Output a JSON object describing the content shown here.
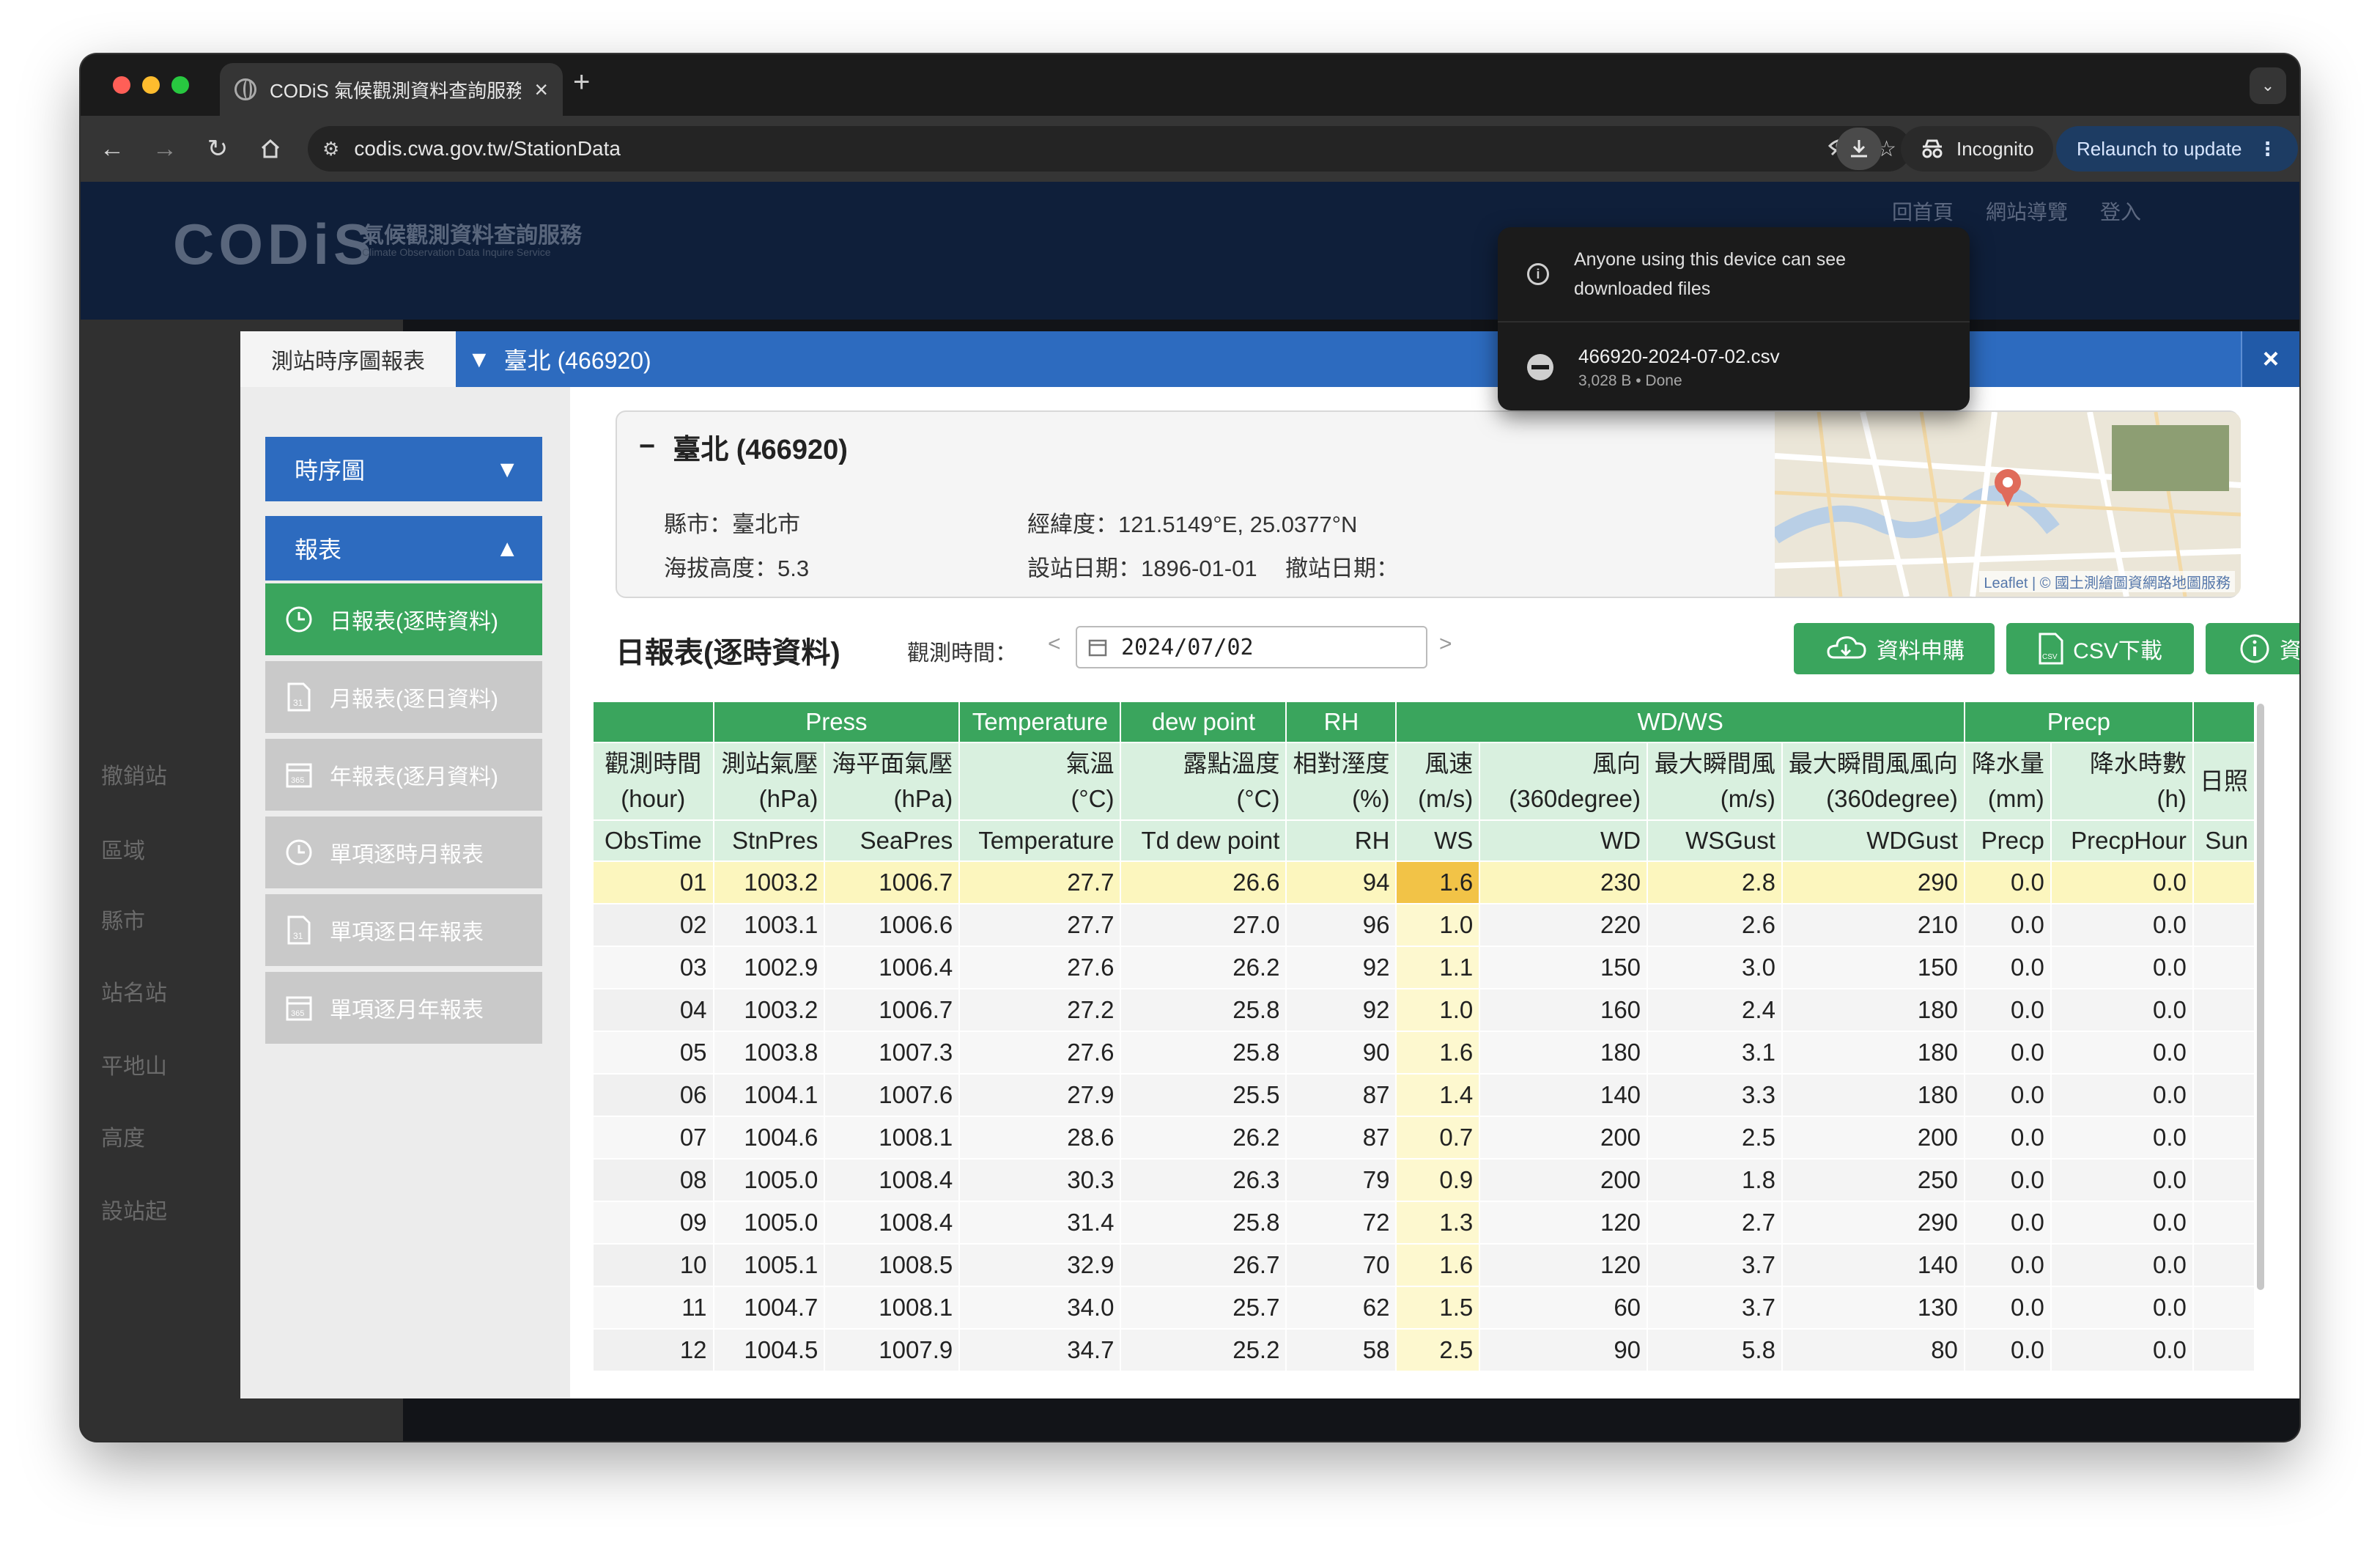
{
  "browser": {
    "tab_title": "CODiS 氣候觀測資料查詢服務",
    "url": "codis.cwa.gov.tw/StationData",
    "incognito_label": "Incognito",
    "relaunch_label": "Relaunch to update",
    "traffic_colors": [
      "#ff5f57",
      "#febc2e",
      "#28c840"
    ]
  },
  "download_bubble": {
    "warning": "Anyone using this device can see downloaded files",
    "file_name": "466920-2024-07-02.csv",
    "file_meta": "3,028 B • Done"
  },
  "site": {
    "logo": "CODiS",
    "name": "氣候觀測資料查詢服務",
    "subtitle": "Climate Observation Data Inquire Service",
    "links": [
      "回首頁",
      "網站導覽",
      "登入"
    ],
    "left_labels": [
      "撤銷站",
      "區域",
      "縣市",
      "站名站",
      "平地山",
      "高度",
      "設站起"
    ]
  },
  "modal": {
    "tab_label": "測站時序圖報表",
    "station_tab": "臺北 (466920)",
    "close": "×",
    "accent_blue": "#2d6bbf",
    "accent_green": "#3aa55d"
  },
  "sidebar": {
    "timeseries": "時序圖",
    "reports": "報表",
    "items": [
      {
        "label": "日報表(逐時資料)",
        "icon": "clock-icon",
        "active": true
      },
      {
        "label": "月報表(逐日資料)",
        "icon": "document-icon",
        "active": false
      },
      {
        "label": "年報表(逐月資料)",
        "icon": "calendar-icon",
        "active": false
      },
      {
        "label": "單項逐時月報表",
        "icon": "clock-icon",
        "active": false
      },
      {
        "label": "單項逐日年報表",
        "icon": "document-icon",
        "active": false
      },
      {
        "label": "單項逐月年報表",
        "icon": "calendar-icon",
        "active": false
      }
    ]
  },
  "station": {
    "name": "臺北 (466920)",
    "county": "縣市：臺北市",
    "altitude": "海拔高度：5.3",
    "coords": "經緯度：121.5149°E, 25.0377°N",
    "established": "設站日期：1896-01-01",
    "removed": "撤站日期：",
    "map_attribution": "Leaflet | © 國土測繪圖資網路地圖服務"
  },
  "report": {
    "title": "日報表(逐時資料)",
    "obs_label": "觀測時間：",
    "date": "2024/07/02",
    "btn_apply": "資料申購",
    "btn_csv": "CSV下載",
    "btn_info": "資料說明"
  },
  "table": {
    "groups": [
      "",
      "Press",
      "Temperature",
      "dew point",
      "RH",
      "WD/WS",
      "Precp",
      ""
    ],
    "headers_zh": [
      "觀測時間",
      "測站氣壓",
      "海平面氣壓",
      "氣溫",
      "露點溫度",
      "相對溼度",
      "風速",
      "風向",
      "最大瞬間風",
      "最大瞬間風風向",
      "降水量",
      "降水時數",
      "日照"
    ],
    "headers_unit": [
      "(hour)",
      "(hPa)",
      "(hPa)",
      "(°C)",
      "(°C)",
      "(%)",
      "(m/s)",
      "(360degree)",
      "(m/s)",
      "(360degree)",
      "(mm)",
      "(h)",
      ""
    ],
    "codes": [
      "ObsTime",
      "StnPres",
      "SeaPres",
      "Temperature",
      "Td dew point",
      "RH",
      "WS",
      "WD",
      "WSGust",
      "WDGust",
      "Precp",
      "PrecpHour",
      "Sun"
    ],
    "rows": [
      [
        "01",
        "1003.2",
        "1006.7",
        "27.7",
        "26.6",
        "94",
        "1.6",
        "230",
        "2.8",
        "290",
        "0.0",
        "0.0",
        ""
      ],
      [
        "02",
        "1003.1",
        "1006.6",
        "27.7",
        "27.0",
        "96",
        "1.0",
        "220",
        "2.6",
        "210",
        "0.0",
        "0.0",
        ""
      ],
      [
        "03",
        "1002.9",
        "1006.4",
        "27.6",
        "26.2",
        "92",
        "1.1",
        "150",
        "3.0",
        "150",
        "0.0",
        "0.0",
        ""
      ],
      [
        "04",
        "1003.2",
        "1006.7",
        "27.2",
        "25.8",
        "92",
        "1.0",
        "160",
        "2.4",
        "180",
        "0.0",
        "0.0",
        ""
      ],
      [
        "05",
        "1003.8",
        "1007.3",
        "27.6",
        "25.8",
        "90",
        "1.6",
        "180",
        "3.1",
        "180",
        "0.0",
        "0.0",
        ""
      ],
      [
        "06",
        "1004.1",
        "1007.6",
        "27.9",
        "25.5",
        "87",
        "1.4",
        "140",
        "3.3",
        "180",
        "0.0",
        "0.0",
        ""
      ],
      [
        "07",
        "1004.6",
        "1008.1",
        "28.6",
        "26.2",
        "87",
        "0.7",
        "200",
        "2.5",
        "200",
        "0.0",
        "0.0",
        ""
      ],
      [
        "08",
        "1005.0",
        "1008.4",
        "30.3",
        "26.3",
        "79",
        "0.9",
        "200",
        "1.8",
        "250",
        "0.0",
        "0.0",
        ""
      ],
      [
        "09",
        "1005.0",
        "1008.4",
        "31.4",
        "25.8",
        "72",
        "1.3",
        "120",
        "2.7",
        "290",
        "0.0",
        "0.0",
        ""
      ],
      [
        "10",
        "1005.1",
        "1008.5",
        "32.9",
        "26.7",
        "70",
        "1.6",
        "120",
        "3.7",
        "140",
        "0.0",
        "0.0",
        ""
      ],
      [
        "11",
        "1004.7",
        "1008.1",
        "34.0",
        "25.7",
        "62",
        "1.5",
        "60",
        "3.7",
        "130",
        "0.0",
        "0.0",
        ""
      ],
      [
        "12",
        "1004.5",
        "1007.9",
        "34.7",
        "25.2",
        "58",
        "2.5",
        "90",
        "5.8",
        "80",
        "0.0",
        "0.0",
        ""
      ]
    ]
  }
}
